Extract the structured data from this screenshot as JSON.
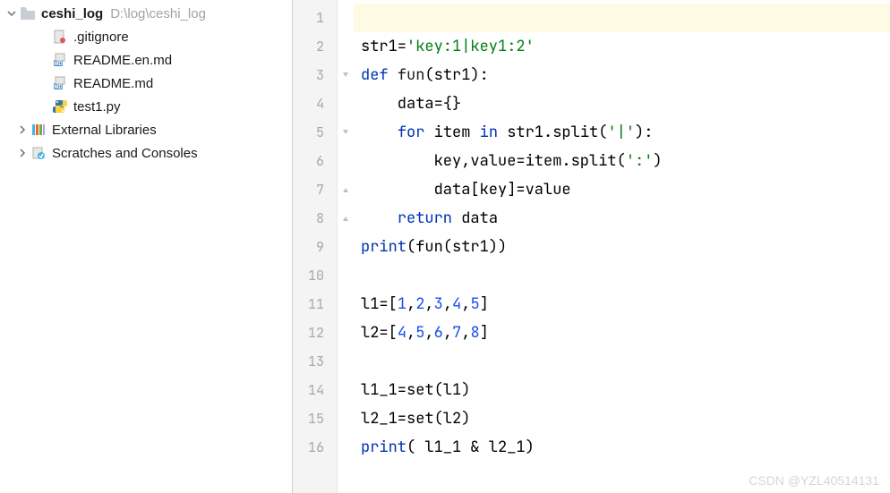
{
  "project_tree": {
    "root": {
      "name": "ceshi_log",
      "path": "D:\\log\\ceshi_log"
    },
    "files": [
      {
        "name": ".gitignore",
        "icon": "gitignore"
      },
      {
        "name": "README.en.md",
        "icon": "md"
      },
      {
        "name": "README.md",
        "icon": "md"
      },
      {
        "name": "test1.py",
        "icon": "py"
      }
    ],
    "external_libraries": "External Libraries",
    "scratches": "Scratches and Consoles"
  },
  "editor": {
    "lines": [
      "1",
      "2",
      "3",
      "4",
      "5",
      "6",
      "7",
      "8",
      "9",
      "10",
      "11",
      "12",
      "13",
      "14",
      "15",
      "16"
    ],
    "code": [
      {
        "n": 1,
        "tokens": []
      },
      {
        "n": 2,
        "tokens": [
          [
            "",
            "str1="
          ],
          [
            "str",
            "'key:1|key1:2'"
          ]
        ]
      },
      {
        "n": 3,
        "tokens": [
          [
            "kw",
            "def"
          ],
          [
            "",
            " "
          ],
          [
            "fn",
            "fun"
          ],
          [
            "",
            "(str1):"
          ]
        ]
      },
      {
        "n": 4,
        "tokens": [
          [
            "",
            "    data={}"
          ]
        ]
      },
      {
        "n": 5,
        "tokens": [
          [
            "",
            "    "
          ],
          [
            "kw",
            "for"
          ],
          [
            "",
            " item "
          ],
          [
            "kw",
            "in"
          ],
          [
            "",
            " str1.split("
          ],
          [
            "str",
            "'|'"
          ],
          [
            "",
            "):"
          ]
        ]
      },
      {
        "n": 6,
        "tokens": [
          [
            "",
            "        key,value=item.split("
          ],
          [
            "str",
            "':'"
          ],
          [
            "",
            ")"
          ]
        ]
      },
      {
        "n": 7,
        "tokens": [
          [
            "",
            "        data[key]=value"
          ]
        ]
      },
      {
        "n": 8,
        "tokens": [
          [
            "",
            "    "
          ],
          [
            "kw",
            "return"
          ],
          [
            "",
            " data"
          ]
        ]
      },
      {
        "n": 9,
        "tokens": [
          [
            "kw",
            "print"
          ],
          [
            "",
            "(fun(str1))"
          ]
        ]
      },
      {
        "n": 10,
        "tokens": []
      },
      {
        "n": 11,
        "tokens": [
          [
            "",
            "l1=["
          ],
          [
            "num",
            "1"
          ],
          [
            "",
            ","
          ],
          [
            "num",
            "2"
          ],
          [
            "",
            ","
          ],
          [
            "num",
            "3"
          ],
          [
            "",
            ","
          ],
          [
            "num",
            "4"
          ],
          [
            "",
            ","
          ],
          [
            "num",
            "5"
          ],
          [
            "",
            "]"
          ]
        ]
      },
      {
        "n": 12,
        "tokens": [
          [
            "",
            "l2=["
          ],
          [
            "num",
            "4"
          ],
          [
            "",
            ","
          ],
          [
            "num",
            "5"
          ],
          [
            "",
            ","
          ],
          [
            "num",
            "6"
          ],
          [
            "",
            ","
          ],
          [
            "num",
            "7"
          ],
          [
            "",
            ","
          ],
          [
            "num",
            "8"
          ],
          [
            "",
            "]"
          ]
        ]
      },
      {
        "n": 13,
        "tokens": []
      },
      {
        "n": 14,
        "tokens": [
          [
            "",
            "l1_1=set(l1)"
          ]
        ]
      },
      {
        "n": 15,
        "tokens": [
          [
            "",
            "l2_1=set(l2)"
          ]
        ]
      },
      {
        "n": 16,
        "tokens": [
          [
            "kw",
            "print"
          ],
          [
            "",
            "( l1_1 & l2_1)"
          ]
        ]
      }
    ],
    "current_line": 1
  },
  "watermark": "CSDN @YZL40514131"
}
